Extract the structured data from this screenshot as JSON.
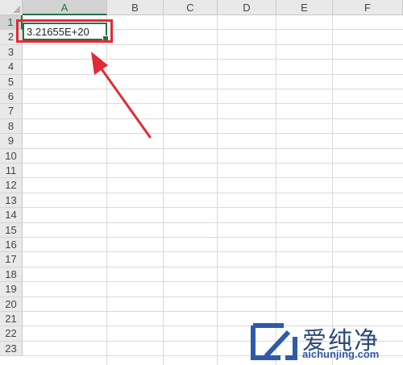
{
  "sheet": {
    "columns": [
      "A",
      "B",
      "C",
      "D",
      "E",
      "F"
    ],
    "rows": [
      "1",
      "2",
      "3",
      "4",
      "5",
      "6",
      "7",
      "8",
      "9",
      "10",
      "11",
      "12",
      "13",
      "14",
      "15",
      "16",
      "17",
      "18",
      "19",
      "20",
      "21",
      "22",
      "23"
    ],
    "selected_column": "A",
    "selected_row": "1",
    "active_cell_value": "3.21655E+20"
  },
  "annotation": {
    "color": "#e02b36"
  },
  "watermark": {
    "title": "爱纯净",
    "url": "aichunjing.com"
  },
  "colors": {
    "accent": "#217346",
    "header_bg": "#e9e9e9",
    "grid": "#dadada"
  }
}
